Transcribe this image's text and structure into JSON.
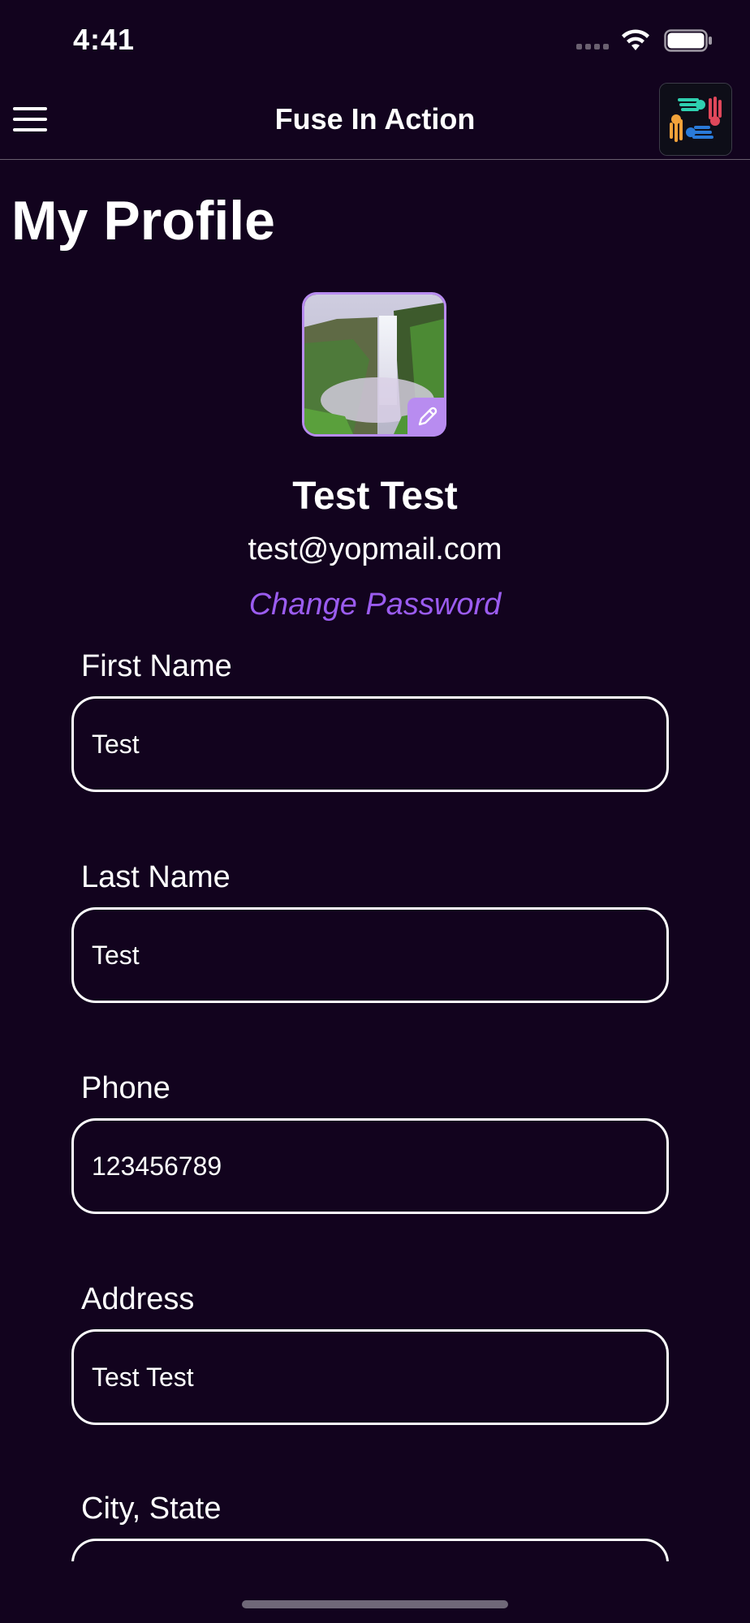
{
  "status_bar": {
    "time": "4:41"
  },
  "header": {
    "title": "Fuse In Action"
  },
  "page": {
    "title": "My Profile"
  },
  "profile": {
    "name": "Test Test",
    "email": "test@yopmail.com",
    "change_password_label": "Change Password"
  },
  "fields": [
    {
      "label": "First Name",
      "value": "Test"
    },
    {
      "label": "Last Name",
      "value": "Test"
    },
    {
      "label": "Phone",
      "value": "123456789"
    },
    {
      "label": "Address",
      "value": "Test Test"
    },
    {
      "label": "City, State",
      "value": ""
    }
  ],
  "colors": {
    "background": "#12031e",
    "accent": "#9b5cf0",
    "avatar_border": "#b88cf0"
  }
}
